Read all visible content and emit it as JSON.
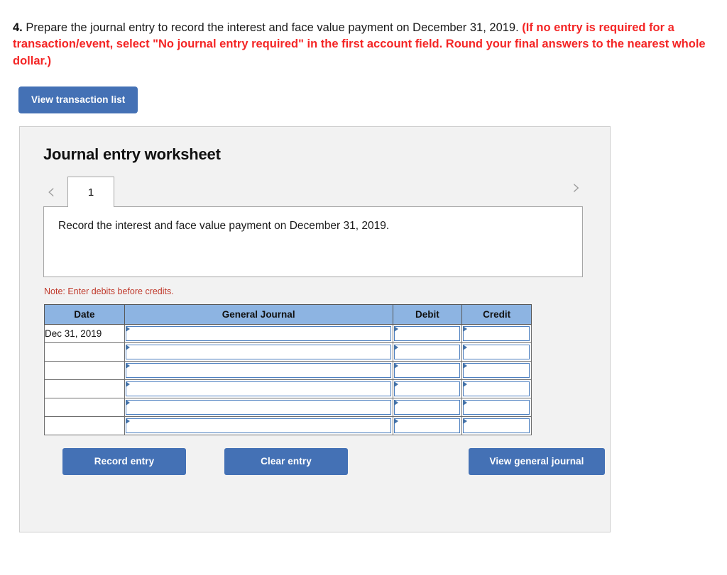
{
  "question": {
    "number": "4.",
    "main_text": " Prepare the journal entry to record the interest and face value payment on December 31, 2019. ",
    "red_text": "(If no entry is required for a transaction/event, select \"No journal entry required\" in the first account field. Round your final answers to the nearest whole dollar.)"
  },
  "toolbar": {
    "view_transaction_list_label": "View transaction list"
  },
  "worksheet": {
    "title": "Journal entry worksheet",
    "prev_chevron": "‹",
    "next_chevron": "›",
    "tabs": [
      {
        "label": "1",
        "active": true
      }
    ],
    "description": "Record the interest and face value payment on December 31, 2019.",
    "note": "Note: Enter debits before credits."
  },
  "table": {
    "headers": [
      "Date",
      "General Journal",
      "Debit",
      "Credit"
    ],
    "rows": [
      {
        "date": "Dec 31, 2019",
        "general_journal": "",
        "debit": "",
        "credit": ""
      },
      {
        "date": "",
        "general_journal": "",
        "debit": "",
        "credit": ""
      },
      {
        "date": "",
        "general_journal": "",
        "debit": "",
        "credit": ""
      },
      {
        "date": "",
        "general_journal": "",
        "debit": "",
        "credit": ""
      },
      {
        "date": "",
        "general_journal": "",
        "debit": "",
        "credit": ""
      },
      {
        "date": "",
        "general_journal": "",
        "debit": "",
        "credit": ""
      }
    ]
  },
  "actions": {
    "record_entry_label": "Record entry",
    "clear_entry_label": "Clear entry",
    "view_general_journal_label": "View general journal"
  },
  "colors": {
    "button_blue": "#4471b5",
    "table_header_blue": "#8db4e2",
    "red_text": "#f42525",
    "note_red": "#c0392b",
    "panel_bg": "#f2f2f2",
    "select_border_blue": "#4c7fc0"
  }
}
